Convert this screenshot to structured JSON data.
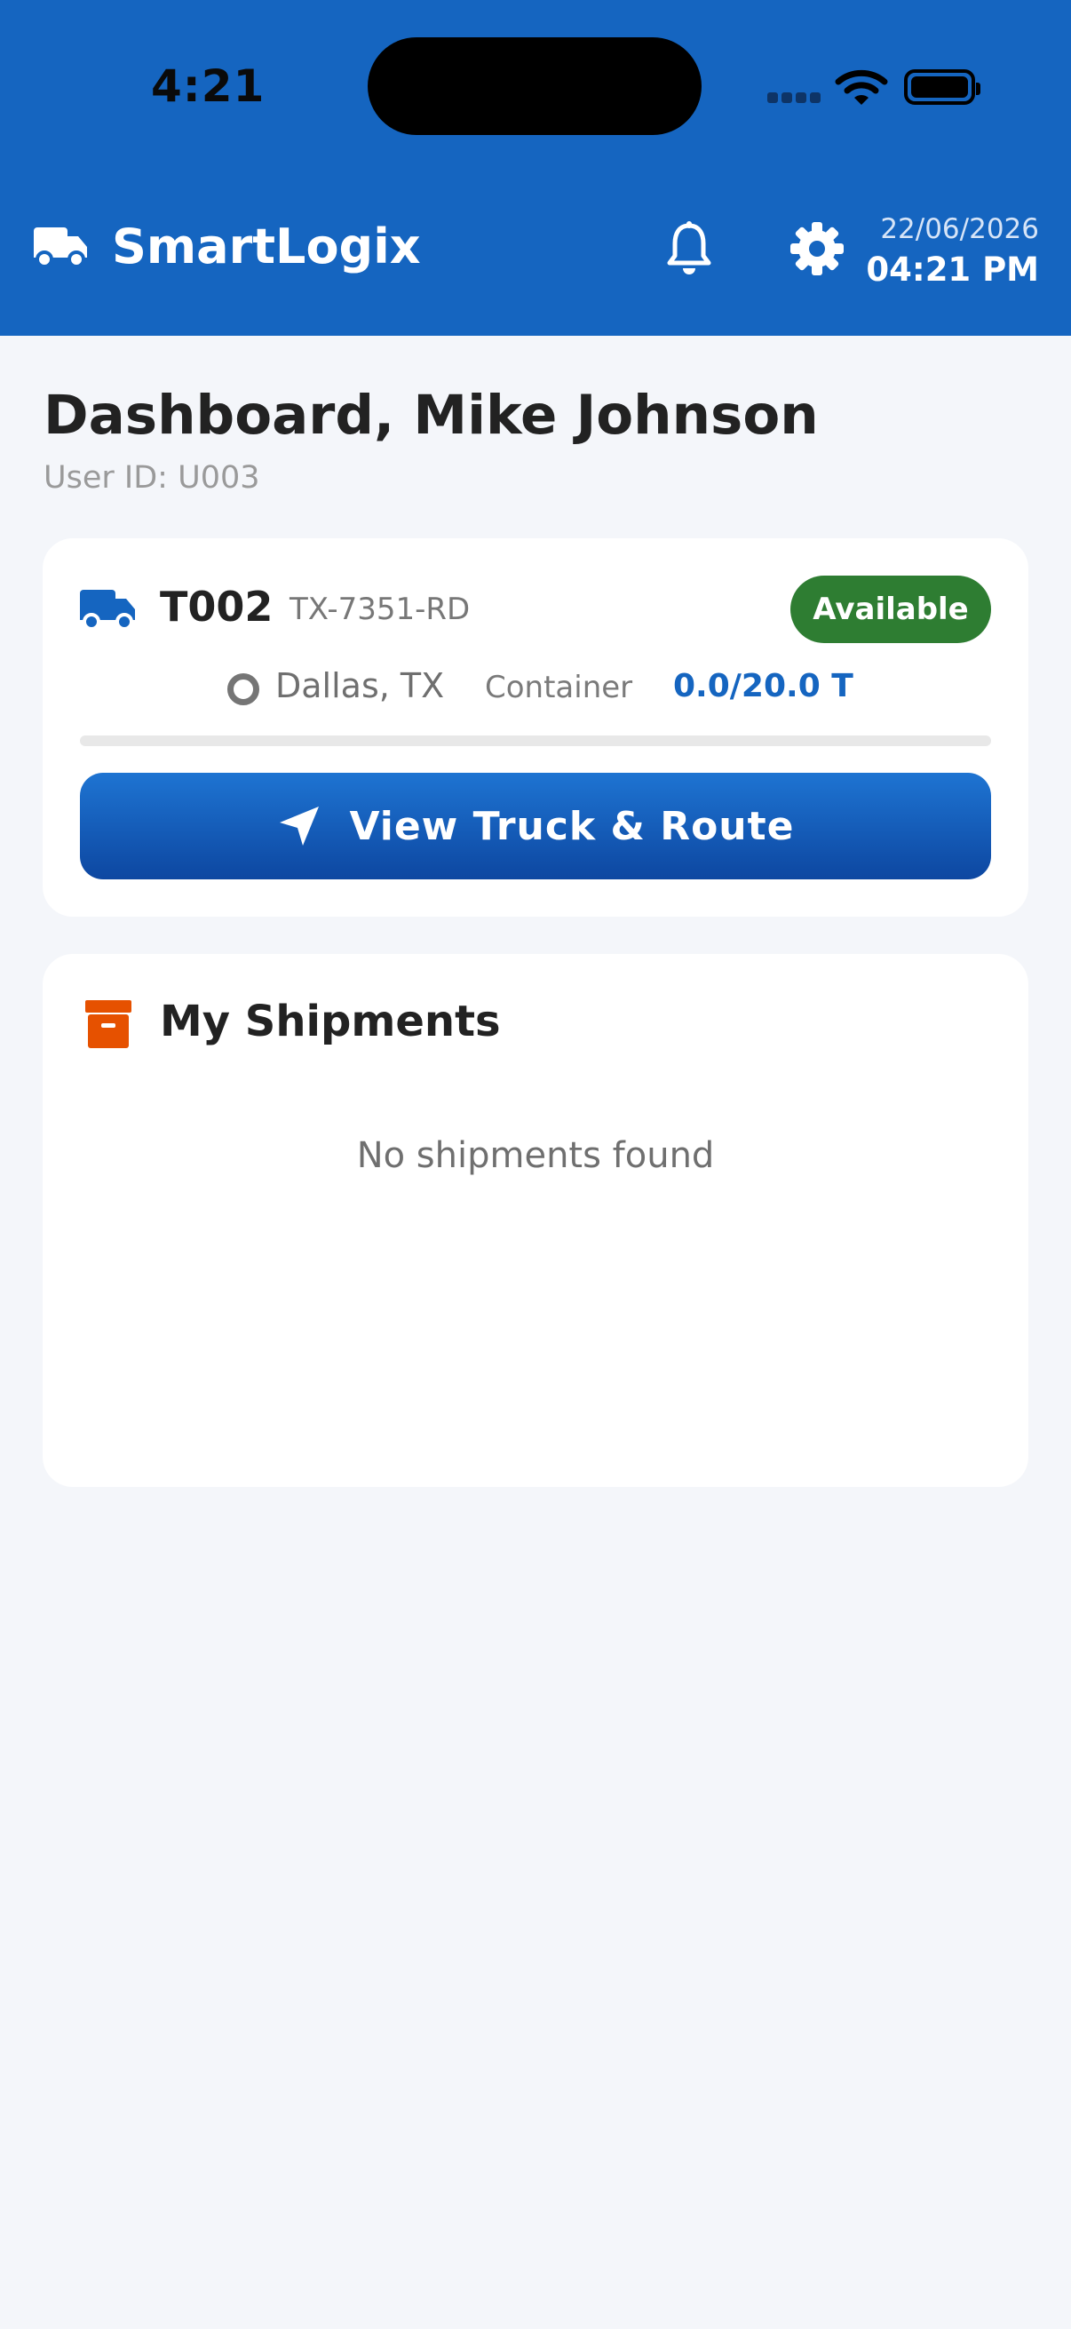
{
  "status_bar": {
    "time": "4:21"
  },
  "app_bar": {
    "title": "SmartLogix",
    "date": "22/06/2026",
    "time": "04:21 PM",
    "logo_icon": "truck-icon",
    "notification_icon": "bell-icon",
    "settings_icon": "gear-icon"
  },
  "greeting": {
    "title": "Dashboard, Mike Johnson",
    "user_id": "User ID: U003"
  },
  "truck_card": {
    "truck_id": "T002",
    "plate": "TX-7351-RD",
    "status": "Available",
    "location": "Dallas, TX",
    "container_label": "Container",
    "capacity": "0.0/20.0 T",
    "load_fraction": 0.0,
    "button_label": "View Truck & Route",
    "button_icon": "navigation-arrow-icon"
  },
  "shipments": {
    "title": "My Shipments",
    "empty_text": "No shipments found",
    "icon": "archive-box-icon"
  },
  "colors": {
    "primary": "#1565c0",
    "available": "#2e7d32",
    "shipments_accent": "#e65100",
    "background": "#f4f6fa"
  }
}
